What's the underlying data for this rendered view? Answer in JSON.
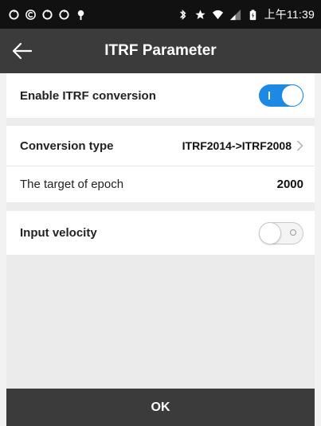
{
  "status_bar": {
    "time": "上午11:39",
    "left_icons": [
      "sync-icon",
      "copyright-icon",
      "sync-icon",
      "sync-icon",
      "location-pin-icon"
    ],
    "right_icons": [
      "bluetooth-icon",
      "star-icon",
      "wifi-icon",
      "signal-icon",
      "battery-icon"
    ]
  },
  "app_bar": {
    "title": "ITRF Parameter",
    "back_icon": "arrow-left-icon"
  },
  "settings": {
    "enable_conversion": {
      "label": "Enable ITRF conversion",
      "enabled": true
    },
    "conversion_type": {
      "label": "Conversion type",
      "value": "ITRF2014->ITRF2008",
      "icon": "chevron-right-icon"
    },
    "target_epoch": {
      "label": "The target of epoch",
      "value": "2000"
    },
    "input_velocity": {
      "label": "Input velocity",
      "enabled": false
    }
  },
  "footer": {
    "ok_label": "OK"
  },
  "colors": {
    "app_bar": "#3b3b3b",
    "status_bar": "#111111",
    "toggle_on": "#1e88e5",
    "background": "#f2f2f2"
  }
}
